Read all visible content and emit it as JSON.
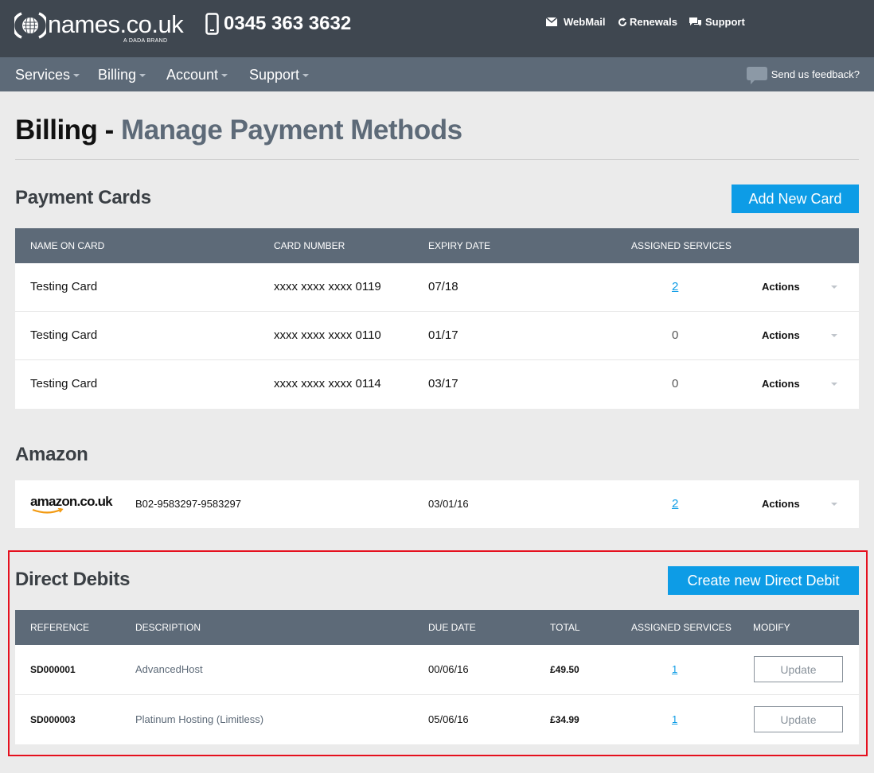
{
  "brand": {
    "name": "names.co.uk",
    "sub": "A DADA BRAND",
    "phone": "0345 363 3632"
  },
  "toplinks": [
    {
      "label": "WebMail",
      "icon": "mail-icon"
    },
    {
      "label": "Renewals",
      "icon": "refresh-icon"
    },
    {
      "label": "Support",
      "icon": "chat-icon"
    }
  ],
  "nav": {
    "items": [
      "Services",
      "Billing",
      "Account",
      "Support"
    ],
    "feedback": "Send us feedback?"
  },
  "page": {
    "title": "Billing -",
    "subtitle": "Manage Payment Methods"
  },
  "cards": {
    "title": "Payment Cards",
    "add_label": "Add New Card",
    "headers": [
      "NAME ON CARD",
      "CARD NUMBER",
      "EXPIRY DATE",
      "ASSIGNED SERVICES"
    ],
    "rows": [
      {
        "name": "Testing Card",
        "number": "xxxx xxxx xxxx 0119",
        "expiry": "07/18",
        "assigned": "2",
        "actions": "Actions"
      },
      {
        "name": "Testing Card",
        "number": "xxxx xxxx xxxx 0110",
        "expiry": "01/17",
        "assigned": "0",
        "actions": "Actions"
      },
      {
        "name": "Testing Card",
        "number": "xxxx xxxx xxxx 0114",
        "expiry": "03/17",
        "assigned": "0",
        "actions": "Actions"
      }
    ]
  },
  "amazon": {
    "title": "Amazon",
    "logo": "amazon.co.uk",
    "reference": "B02-9583297-9583297",
    "date": "03/01/16",
    "assigned": "2",
    "actions": "Actions"
  },
  "debits": {
    "title": "Direct Debits",
    "create_label": "Create new Direct Debit",
    "headers": [
      "REFERENCE",
      "DESCRIPTION",
      "DUE DATE",
      "TOTAL",
      "ASSIGNED SERVICES",
      "MODIFY"
    ],
    "rows": [
      {
        "reference": "SD000001",
        "description": "AdvancedHost",
        "due": "00/06/16",
        "total": "£49.50",
        "assigned": "1",
        "modify": "Update"
      },
      {
        "reference": "SD000003",
        "description": "Platinum Hosting (Limitless)",
        "due": "05/06/16",
        "total": "£34.99",
        "assigned": "1",
        "modify": "Update"
      }
    ]
  },
  "colors": {
    "topbar": "#3f4750",
    "navbar": "#5d6a78",
    "accent": "#0d9ce6",
    "highlight": "#e5101e"
  }
}
